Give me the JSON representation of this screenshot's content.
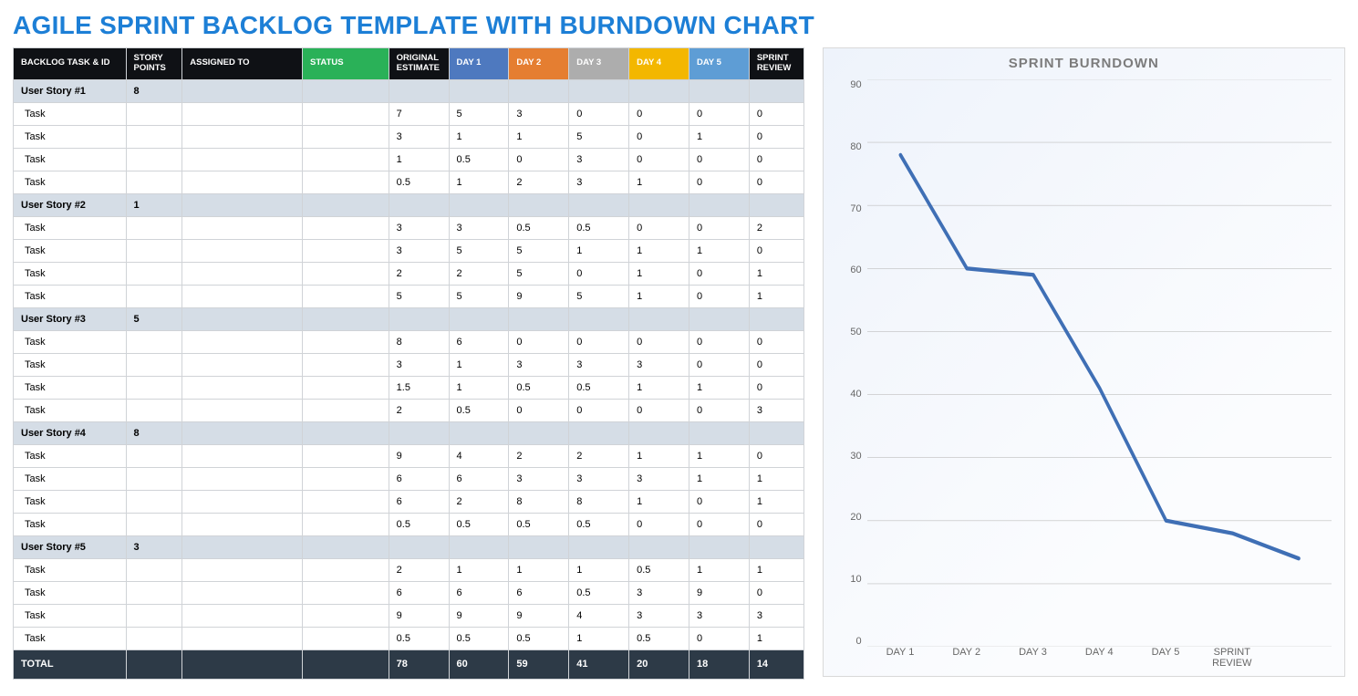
{
  "title": "AGILE SPRINT BACKLOG TEMPLATE WITH BURNDOWN CHART",
  "headers": {
    "task": "BACKLOG TASK & ID",
    "points": "STORY POINTS",
    "assign": "ASSIGNED TO",
    "status": "STATUS",
    "orig": "ORIGINAL ESTIMATE",
    "day1": "DAY 1",
    "day2": "DAY 2",
    "day3": "DAY 3",
    "day4": "DAY 4",
    "day5": "DAY 5",
    "review": "SPRINT REVIEW"
  },
  "stories": [
    {
      "name": "User Story #1",
      "points": "8",
      "tasks": [
        {
          "n": "Task",
          "orig": "7",
          "d": [
            "5",
            "3",
            "0",
            "0",
            "0"
          ],
          "rev": "0"
        },
        {
          "n": "Task",
          "orig": "3",
          "d": [
            "1",
            "1",
            "5",
            "0",
            "1"
          ],
          "rev": "0"
        },
        {
          "n": "Task",
          "orig": "1",
          "d": [
            "0.5",
            "0",
            "3",
            "0",
            "0"
          ],
          "rev": "0"
        },
        {
          "n": "Task",
          "orig": "0.5",
          "d": [
            "1",
            "2",
            "3",
            "1",
            "0"
          ],
          "rev": "0"
        }
      ]
    },
    {
      "name": "User Story #2",
      "points": "1",
      "tasks": [
        {
          "n": "Task",
          "orig": "3",
          "d": [
            "3",
            "0.5",
            "0.5",
            "0",
            "0"
          ],
          "rev": "2"
        },
        {
          "n": "Task",
          "orig": "3",
          "d": [
            "5",
            "5",
            "1",
            "1",
            "1"
          ],
          "rev": "0"
        },
        {
          "n": "Task",
          "orig": "2",
          "d": [
            "2",
            "5",
            "0",
            "1",
            "0"
          ],
          "rev": "1"
        },
        {
          "n": "Task",
          "orig": "5",
          "d": [
            "5",
            "9",
            "5",
            "1",
            "0"
          ],
          "rev": "1"
        }
      ]
    },
    {
      "name": "User Story #3",
      "points": "5",
      "tasks": [
        {
          "n": "Task",
          "orig": "8",
          "d": [
            "6",
            "0",
            "0",
            "0",
            "0"
          ],
          "rev": "0"
        },
        {
          "n": "Task",
          "orig": "3",
          "d": [
            "1",
            "3",
            "3",
            "3",
            "0"
          ],
          "rev": "0"
        },
        {
          "n": "Task",
          "orig": "1.5",
          "d": [
            "1",
            "0.5",
            "0.5",
            "1",
            "1"
          ],
          "rev": "0"
        },
        {
          "n": "Task",
          "orig": "2",
          "d": [
            "0.5",
            "0",
            "0",
            "0",
            "0"
          ],
          "rev": "3"
        }
      ]
    },
    {
      "name": "User Story #4",
      "points": "8",
      "tasks": [
        {
          "n": "Task",
          "orig": "9",
          "d": [
            "4",
            "2",
            "2",
            "1",
            "1"
          ],
          "rev": "0"
        },
        {
          "n": "Task",
          "orig": "6",
          "d": [
            "6",
            "3",
            "3",
            "3",
            "1"
          ],
          "rev": "1"
        },
        {
          "n": "Task",
          "orig": "6",
          "d": [
            "2",
            "8",
            "8",
            "1",
            "0"
          ],
          "rev": "1"
        },
        {
          "n": "Task",
          "orig": "0.5",
          "d": [
            "0.5",
            "0.5",
            "0.5",
            "0",
            "0"
          ],
          "rev": "0"
        }
      ]
    },
    {
      "name": "User Story #5",
      "points": "3",
      "tasks": [
        {
          "n": "Task",
          "orig": "2",
          "d": [
            "1",
            "1",
            "1",
            "0.5",
            "1"
          ],
          "rev": "1"
        },
        {
          "n": "Task",
          "orig": "6",
          "d": [
            "6",
            "6",
            "0.5",
            "3",
            "9"
          ],
          "rev": "0"
        },
        {
          "n": "Task",
          "orig": "9",
          "d": [
            "9",
            "9",
            "4",
            "3",
            "3"
          ],
          "rev": "3"
        },
        {
          "n": "Task",
          "orig": "0.5",
          "d": [
            "0.5",
            "0.5",
            "1",
            "0.5",
            "0"
          ],
          "rev": "1"
        }
      ]
    }
  ],
  "total": {
    "label": "TOTAL",
    "orig": "78",
    "d": [
      "60",
      "59",
      "41",
      "20",
      "18"
    ],
    "rev": "14"
  },
  "chart_data": {
    "type": "line",
    "title": "SPRINT BURNDOWN",
    "categories": [
      "DAY 1",
      "DAY 2",
      "DAY 3",
      "DAY 4",
      "DAY 5",
      "SPRINT REVIEW"
    ],
    "values": [
      78,
      60,
      59,
      41,
      20,
      18,
      14
    ],
    "ylim": [
      0,
      90
    ],
    "yticks": [
      90,
      80,
      70,
      60,
      50,
      40,
      30,
      20,
      10,
      0
    ],
    "xlabel": "",
    "ylabel": ""
  }
}
